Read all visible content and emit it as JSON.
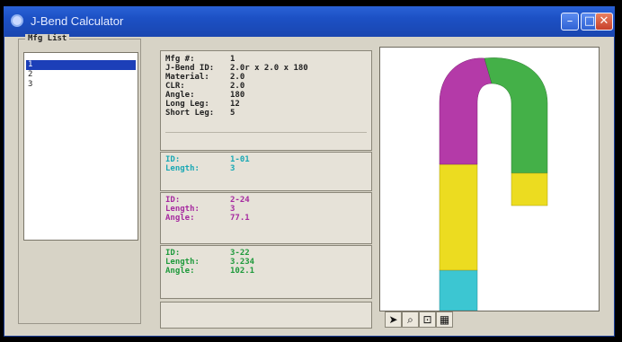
{
  "window": {
    "title": "J-Bend Calculator",
    "buttons": {
      "minimize": "–",
      "maximize": "□",
      "close": "✕"
    }
  },
  "mfg_list": {
    "label": "Mfg List",
    "items": [
      "1",
      "2",
      "3"
    ],
    "selected_index": 0
  },
  "summary": {
    "rows": [
      {
        "label": "Mfg #:",
        "value": "1"
      },
      {
        "label": "J-Bend ID:",
        "value": "2.0r x 2.0 x 180"
      },
      {
        "label": "Material:",
        "value": "2.0"
      },
      {
        "label": "CLR:",
        "value": "2.0"
      },
      {
        "label": "Angle:",
        "value": "180"
      },
      {
        "label": "Long Leg:",
        "value": "12"
      },
      {
        "label": "Short Leg:",
        "value": "5"
      }
    ]
  },
  "segments": [
    {
      "color": "#1aa8b4",
      "rows": [
        {
          "label": "ID:",
          "value": "1-01"
        },
        {
          "label": "Length:",
          "value": "3"
        }
      ]
    },
    {
      "color": "#a62aa0",
      "rows": [
        {
          "label": "ID:",
          "value": "2-24"
        },
        {
          "label": "Length:",
          "value": "3"
        },
        {
          "label": "Angle:",
          "value": "77.1"
        }
      ]
    },
    {
      "color": "#1f9a3c",
      "rows": [
        {
          "label": "ID:",
          "value": "3-22"
        },
        {
          "label": "Length:",
          "value": "3.234"
        },
        {
          "label": "Angle:",
          "value": "102.1"
        }
      ]
    }
  ],
  "pipe_colors": {
    "cyan": "#3cc6d2",
    "yellow": "#ecdc20",
    "magenta": "#b43aa8",
    "green": "#44b048"
  },
  "toolbar": {
    "icons": [
      "select-arrow-icon",
      "zoom-icon",
      "pan-icon",
      "fit-icon"
    ],
    "glyphs": [
      "➤",
      "⌕",
      "⊡",
      "▦"
    ]
  }
}
